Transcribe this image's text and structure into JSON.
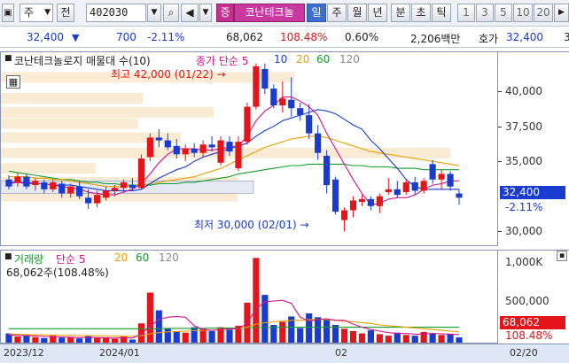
{
  "toolbar": {
    "market_type": "주",
    "prev_label": "전",
    "stock_code": "402030",
    "highlight_button": "증",
    "stock_name": "코난테크놀",
    "periods": [
      "일",
      "주",
      "월",
      "년",
      "분",
      "초",
      "틱"
    ],
    "active_period": "일",
    "numbers": [
      "1",
      "3",
      "5",
      "10",
      "20"
    ]
  },
  "price_row": {
    "price": "32,400",
    "change": "700",
    "change_pct": "-2.11%",
    "volume": "68,062",
    "volume_ratio": "108.48%",
    "turnover": "0.60%",
    "amount": "2,206백만",
    "quote_label": "호가",
    "quote_price": "32,400",
    "cut_off": "3"
  },
  "price_pane": {
    "title": "코난테크놀로지 매물대 수(10)",
    "ma_label": "종가 단순 5",
    "ma_periods": [
      "10",
      "20",
      "60",
      "120"
    ],
    "ma_colors": {
      "ma5": "#d4148c",
      "ma10": "#1a3bd0",
      "ma20": "#e8a100",
      "ma60": "#169b2e",
      "ma120": "#8a8a8a"
    },
    "high_note": "최고 42,000 (01/22) →",
    "low_note": "최저 30,000 (02/01) →",
    "y_ticks": [
      "40,000",
      "37,500",
      "35,000",
      "30,000"
    ],
    "last_price_tag": "32,400",
    "last_change_tag": "-2.11%"
  },
  "volume_pane": {
    "title": "거래량",
    "ma_label": "단순 5",
    "ma_periods": [
      "20",
      "60",
      "120"
    ],
    "volume_text": "68,062주(108.48%)",
    "y_ticks": [
      "1,000K",
      "500,000"
    ],
    "last_volume_tag": "68,062",
    "last_ratio_tag": "108.48%"
  },
  "date_axis": {
    "labels": [
      "2023/12",
      "2024/01",
      "02",
      "02/20"
    ]
  },
  "chart_data": {
    "type": "candlestick",
    "up_color": "#e3141a",
    "down_color": "#1a3bd0",
    "candles": [
      {
        "o": 33700,
        "h": 34000,
        "l": 33000,
        "c": 33200
      },
      {
        "o": 33500,
        "h": 34200,
        "l": 33200,
        "c": 33900
      },
      {
        "o": 33900,
        "h": 34100,
        "l": 33000,
        "c": 33200
      },
      {
        "o": 33300,
        "h": 33800,
        "l": 32900,
        "c": 33600
      },
      {
        "o": 33500,
        "h": 33700,
        "l": 32700,
        "c": 33000
      },
      {
        "o": 33000,
        "h": 33700,
        "l": 32800,
        "c": 33500
      },
      {
        "o": 33400,
        "h": 33600,
        "l": 32400,
        "c": 32700
      },
      {
        "o": 32700,
        "h": 33400,
        "l": 32400,
        "c": 33200
      },
      {
        "o": 33200,
        "h": 33600,
        "l": 32300,
        "c": 32500
      },
      {
        "o": 32400,
        "h": 33000,
        "l": 31600,
        "c": 32000
      },
      {
        "o": 32000,
        "h": 32900,
        "l": 31700,
        "c": 32600
      },
      {
        "o": 32400,
        "h": 33200,
        "l": 32200,
        "c": 32900
      },
      {
        "o": 32900,
        "h": 33300,
        "l": 32500,
        "c": 33100
      },
      {
        "o": 33100,
        "h": 33700,
        "l": 32800,
        "c": 33500
      },
      {
        "o": 33300,
        "h": 33800,
        "l": 32900,
        "c": 33100
      },
      {
        "o": 33100,
        "h": 35500,
        "l": 33000,
        "c": 35200
      },
      {
        "o": 35300,
        "h": 37000,
        "l": 35000,
        "c": 36700
      },
      {
        "o": 36700,
        "h": 37300,
        "l": 36000,
        "c": 36500
      },
      {
        "o": 36500,
        "h": 37000,
        "l": 35800,
        "c": 36000
      },
      {
        "o": 36100,
        "h": 36600,
        "l": 35200,
        "c": 35500
      },
      {
        "o": 35500,
        "h": 36200,
        "l": 35000,
        "c": 35900
      },
      {
        "o": 35900,
        "h": 36300,
        "l": 35300,
        "c": 35600
      },
      {
        "o": 35600,
        "h": 36500,
        "l": 35300,
        "c": 36200
      },
      {
        "o": 36200,
        "h": 36800,
        "l": 35700,
        "c": 36000
      },
      {
        "o": 34900,
        "h": 36800,
        "l": 34700,
        "c": 36500
      },
      {
        "o": 36400,
        "h": 36800,
        "l": 35400,
        "c": 35700
      },
      {
        "o": 34500,
        "h": 36800,
        "l": 34300,
        "c": 36400
      },
      {
        "o": 36400,
        "h": 39200,
        "l": 36200,
        "c": 38900
      },
      {
        "o": 38900,
        "h": 42000,
        "l": 38700,
        "c": 41800
      },
      {
        "o": 41600,
        "h": 42000,
        "l": 39800,
        "c": 40200
      },
      {
        "o": 40200,
        "h": 40500,
        "l": 38800,
        "c": 39000
      },
      {
        "o": 39000,
        "h": 40700,
        "l": 38500,
        "c": 39500
      },
      {
        "o": 39400,
        "h": 41000,
        "l": 38200,
        "c": 38800
      },
      {
        "o": 38800,
        "h": 39200,
        "l": 37900,
        "c": 38300
      },
      {
        "o": 38300,
        "h": 39100,
        "l": 36600,
        "c": 37000
      },
      {
        "o": 37000,
        "h": 37600,
        "l": 35100,
        "c": 35600
      },
      {
        "o": 35400,
        "h": 35800,
        "l": 32700,
        "c": 33300
      },
      {
        "o": 33700,
        "h": 33900,
        "l": 31200,
        "c": 31400
      },
      {
        "o": 30800,
        "h": 31700,
        "l": 30000,
        "c": 31500
      },
      {
        "o": 31500,
        "h": 32500,
        "l": 31000,
        "c": 32200
      },
      {
        "o": 32100,
        "h": 32600,
        "l": 31800,
        "c": 32300
      },
      {
        "o": 32300,
        "h": 32500,
        "l": 31500,
        "c": 31800
      },
      {
        "o": 31800,
        "h": 32700,
        "l": 31300,
        "c": 32500
      },
      {
        "o": 32800,
        "h": 33800,
        "l": 32600,
        "c": 33000
      },
      {
        "o": 33000,
        "h": 33600,
        "l": 32400,
        "c": 32600
      },
      {
        "o": 32800,
        "h": 33700,
        "l": 32600,
        "c": 33500
      },
      {
        "o": 33500,
        "h": 33900,
        "l": 32600,
        "c": 32900
      },
      {
        "o": 32900,
        "h": 33800,
        "l": 32700,
        "c": 33600
      },
      {
        "o": 34800,
        "h": 35100,
        "l": 33400,
        "c": 33700
      },
      {
        "o": 33700,
        "h": 34400,
        "l": 33000,
        "c": 34100
      },
      {
        "o": 34100,
        "h": 34300,
        "l": 32900,
        "c": 33200
      },
      {
        "o": 32700,
        "h": 33000,
        "l": 31900,
        "c": 32400
      }
    ],
    "volumes": [
      120000,
      80000,
      95000,
      70000,
      60000,
      90000,
      65000,
      75000,
      55000,
      85000,
      60000,
      70000,
      50000,
      80000,
      40000,
      250000,
      650000,
      420000,
      180000,
      150000,
      130000,
      200000,
      180000,
      150000,
      200000,
      170000,
      220000,
      520000,
      1100000,
      620000,
      230000,
      270000,
      340000,
      190000,
      380000,
      330000,
      310000,
      230000,
      180000,
      150000,
      120000,
      160000,
      110000,
      90000,
      130000,
      100000,
      90000,
      140000,
      120000,
      100000,
      110000,
      68062
    ],
    "ma5": [
      33400,
      33500,
      33400,
      33400,
      33400,
      33300,
      33200,
      33100,
      33000,
      32800,
      32700,
      32600,
      32600,
      32800,
      33000,
      33400,
      34100,
      34900,
      35500,
      35900,
      35900,
      35900,
      35800,
      35800,
      35900,
      36000,
      36100,
      36800,
      37900,
      38600,
      39000,
      39600,
      39600,
      39300,
      38900,
      38300,
      37000,
      35900,
      34800,
      33700,
      32700,
      31900,
      32000,
      32300,
      32400,
      32400,
      32600,
      33000,
      33300,
      33400,
      33600,
      33600
    ],
    "ma10": [
      33500,
      33500,
      33500,
      33400,
      33400,
      33300,
      33300,
      33300,
      33200,
      33100,
      33000,
      32900,
      32900,
      32900,
      32900,
      33000,
      33400,
      33800,
      34100,
      34400,
      34600,
      35000,
      35300,
      35500,
      35700,
      35900,
      36100,
      36300,
      36800,
      37200,
      37500,
      37900,
      38100,
      38300,
      38500,
      38700,
      38600,
      38400,
      38000,
      37600,
      37300,
      36500,
      35900,
      35200,
      34500,
      33700,
      33200,
      33000,
      33000,
      33000,
      33000,
      33000
    ],
    "ma20": [
      33900,
      33900,
      33900,
      33800,
      33800,
      33700,
      33700,
      33600,
      33500,
      33400,
      33300,
      33200,
      33200,
      33200,
      33200,
      33300,
      33400,
      33500,
      33600,
      33700,
      33800,
      33900,
      34100,
      34300,
      34500,
      34800,
      35100,
      35400,
      35700,
      36000,
      36200,
      36400,
      36600,
      36700,
      36800,
      36800,
      36700,
      36500,
      36300,
      36100,
      35900,
      35700,
      35600,
      35500,
      35400,
      35300,
      35200,
      35100,
      35000,
      34900,
      34800,
      34700
    ],
    "ma60": [
      34300,
      34200,
      34100,
      34000,
      33900,
      33800,
      33700,
      33700,
      33600,
      33500,
      33500,
      33400,
      33400,
      33300,
      33300,
      33300,
      33300,
      33400,
      33400,
      33400,
      33500,
      33500,
      33600,
      33700,
      33800,
      33900,
      34100,
      34200,
      34300,
      34400,
      34500,
      34600,
      34700,
      34700,
      34800,
      34800,
      34800,
      34800,
      34800,
      34700,
      34700,
      34600,
      34600,
      34600,
      34500,
      34500,
      34500,
      34400,
      34400,
      34400,
      34400,
      34400
    ],
    "volume_ma5": [
      100000,
      95000,
      90000,
      85000,
      80000,
      75000,
      72000,
      70000,
      65000,
      68000,
      65000,
      62000,
      60000,
      64000,
      60000,
      110000,
      215000,
      300000,
      330000,
      340000,
      330000,
      220000,
      170000,
      160000,
      170000,
      180000,
      180000,
      250000,
      440000,
      530000,
      540000,
      550000,
      510000,
      330000,
      280000,
      300000,
      310000,
      290000,
      290000,
      240000,
      200000,
      170000,
      150000,
      130000,
      120000,
      120000,
      110000,
      110000,
      120000,
      115000,
      110000,
      105000
    ],
    "volume_ma20": [
      110000,
      108000,
      105000,
      102000,
      100000,
      98000,
      96000,
      94000,
      92000,
      90000,
      88000,
      86000,
      84000,
      84000,
      82000,
      90000,
      115000,
      130000,
      140000,
      145000,
      150000,
      155000,
      160000,
      165000,
      170000,
      175000,
      180000,
      200000,
      240000,
      260000,
      270000,
      280000,
      290000,
      290000,
      300000,
      300000,
      300000,
      290000,
      280000,
      270000,
      260000,
      250000,
      230000,
      220000,
      210000,
      200000,
      190000,
      180000,
      170000,
      160000,
      150000,
      140000
    ],
    "volume_ma60": [
      180000,
      180000,
      180000,
      180000,
      180000,
      180000,
      180000,
      180000,
      180000,
      180000,
      180000,
      180000,
      180000,
      180000,
      180000,
      180000,
      180000,
      180000,
      185000,
      185000,
      185000,
      185000,
      185000,
      190000,
      190000,
      190000,
      190000,
      195000,
      195000,
      195000,
      195000,
      200000,
      200000,
      200000,
      200000,
      200000,
      200000,
      200000,
      200000,
      200000,
      200000,
      200000,
      200000,
      200000,
      200000,
      200000,
      200000,
      200000,
      200000,
      200000,
      200000,
      200000
    ],
    "price_ylim": [
      29000,
      42800
    ],
    "volume_ylim": [
      0,
      1150000
    ],
    "volume_profile": [
      {
        "price": 41000,
        "weight": 0.62
      },
      {
        "price": 39500,
        "weight": 0.3
      },
      {
        "price": 38500,
        "weight": 0.45
      },
      {
        "price": 37700,
        "weight": 0.29
      },
      {
        "price": 36700,
        "weight": 0.38
      },
      {
        "price": 35600,
        "weight": 0.95
      },
      {
        "price": 34500,
        "weight": 0.2
      },
      {
        "price": 33500,
        "weight": 0.5
      },
      {
        "price": 32500,
        "weight": 0.5
      }
    ]
  }
}
